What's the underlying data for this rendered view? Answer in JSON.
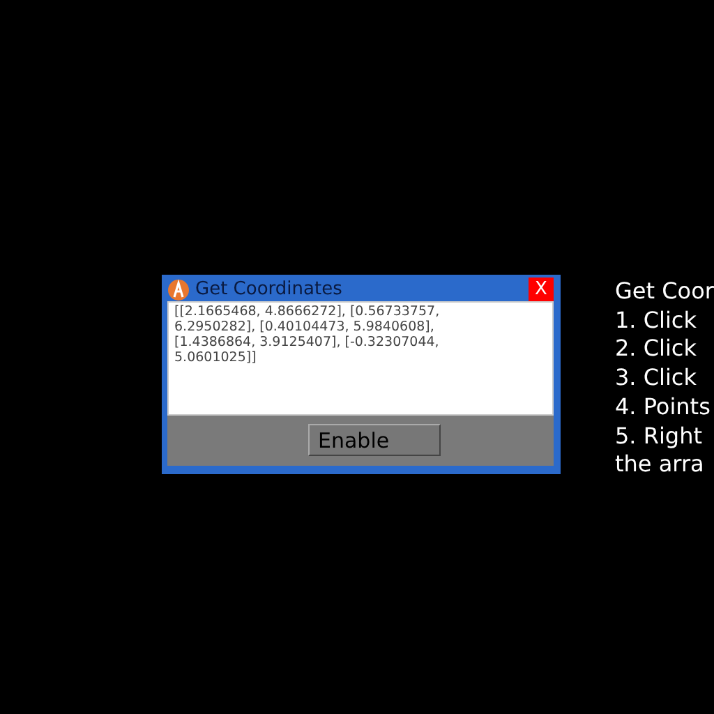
{
  "dialog": {
    "title": "Get Coordinates",
    "close_label": "X",
    "output": "[[2.1665468, 4.8666272], [0.56733757, 6.2950282], [0.40104473, 5.9840608], [1.4386864, 3.9125407], [-0.32307044, 5.0601025]]",
    "button": "Enable"
  },
  "instructions": [
    "Get Coor",
    "1. Click",
    "2. Click",
    "3. Click",
    "4. Points",
    "5. Right",
    "the arra"
  ]
}
